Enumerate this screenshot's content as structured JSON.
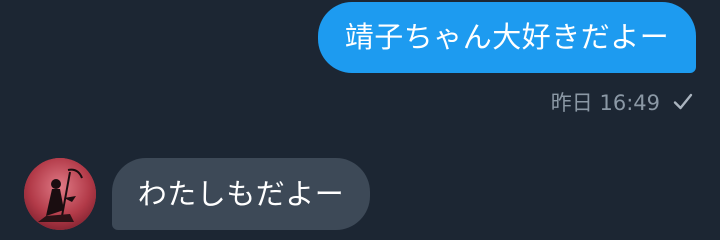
{
  "messages": {
    "outgoing": {
      "text": "靖子ちゃん大好きだよー",
      "timestamp": "昨日 16:49",
      "status_icon": "checkmark-icon"
    },
    "incoming": {
      "text": "わたしもだよー",
      "avatar_icon": "avatar-image"
    }
  },
  "colors": {
    "background": "#1c2633",
    "outgoing_bubble": "#1d9bf0",
    "incoming_bubble": "#3d4957",
    "meta_text": "#8b98a5"
  }
}
